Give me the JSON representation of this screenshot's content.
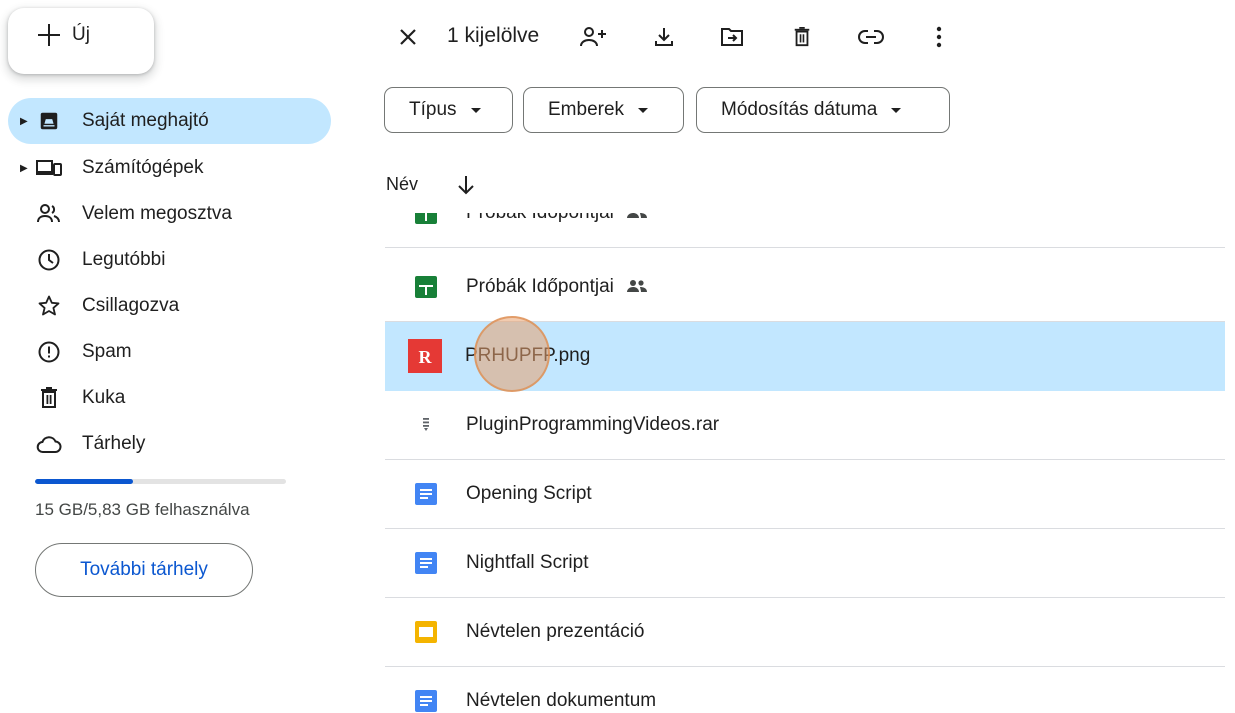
{
  "new_button": {
    "label": "Új"
  },
  "sidebar": {
    "items": [
      {
        "label": "Saját meghajtó",
        "icon": "my-drive-icon",
        "active": true
      },
      {
        "label": "Számítógépek",
        "icon": "computers-icon",
        "active": false
      },
      {
        "label": "Velem megosztva",
        "icon": "shared-with-me-icon",
        "active": false
      },
      {
        "label": "Legutóbbi",
        "icon": "clock-icon",
        "active": false
      },
      {
        "label": "Csillagozva",
        "icon": "star-icon",
        "active": false
      },
      {
        "label": "Spam",
        "icon": "spam-icon",
        "active": false
      },
      {
        "label": "Kuka",
        "icon": "trash-icon",
        "active": false
      },
      {
        "label": "Tárhely",
        "icon": "cloud-icon",
        "active": false
      }
    ],
    "storage": {
      "used_fraction": 0.39,
      "text": "15 GB/5,83 GB felhasználva"
    },
    "more_storage_label": "További tárhely"
  },
  "toolbar": {
    "selected_count": "1 kijelölve",
    "icons": [
      "close-icon",
      "share-person-add-icon",
      "download-icon",
      "move-to-folder-icon",
      "trash-icon",
      "link-icon",
      "more-vert-icon"
    ]
  },
  "filters": [
    {
      "label": "Típus"
    },
    {
      "label": "Emberek"
    },
    {
      "label": "Módosítás dátuma"
    }
  ],
  "list": {
    "column_name": "Név",
    "rows": [
      {
        "name": "Próbák Időpontjai",
        "type": "sheets",
        "shared": true,
        "selected": false
      },
      {
        "name": "Próbák Időpontjai",
        "type": "sheets",
        "shared": true,
        "selected": false
      },
      {
        "name": "PRHUPFP.png",
        "type": "image",
        "shared": false,
        "selected": true
      },
      {
        "name": "PluginProgrammingVideos.rar",
        "type": "archive",
        "shared": false,
        "selected": false
      },
      {
        "name": "Opening Script",
        "type": "docs",
        "shared": false,
        "selected": false
      },
      {
        "name": "Nightfall Script",
        "type": "docs",
        "shared": false,
        "selected": false
      },
      {
        "name": "Névtelen prezentáció",
        "type": "slides",
        "shared": false,
        "selected": false
      },
      {
        "name": "Névtelen dokumentum",
        "type": "docs",
        "shared": false,
        "selected": false
      }
    ]
  },
  "colors": {
    "accent": "#0b57d0",
    "selected_bg": "#c2e7ff",
    "sheets": "#188038",
    "docs": "#4285f4",
    "slides": "#f4b400",
    "image": "#e53935"
  }
}
